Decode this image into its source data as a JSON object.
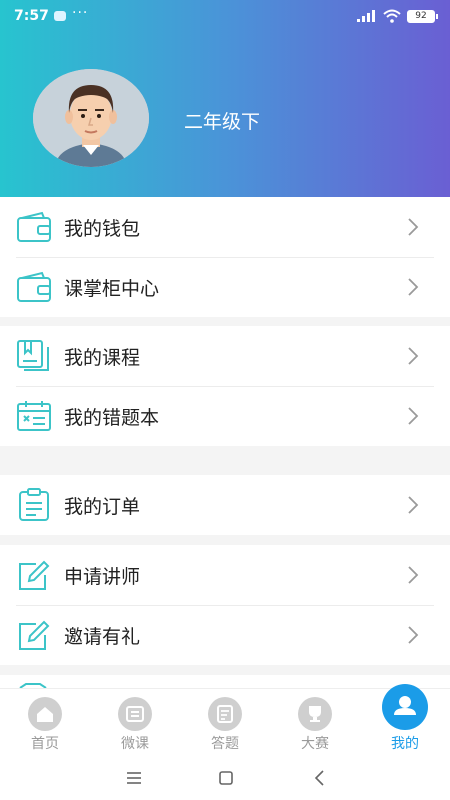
{
  "status": {
    "time": "7:57",
    "dots": "···",
    "battery": "92"
  },
  "profile": {
    "grade": "二年级下"
  },
  "menu_groups": [
    [
      {
        "label": "我的钱包"
      },
      {
        "label": "课掌柜中心"
      }
    ],
    [
      {
        "label": "我的课程"
      },
      {
        "label": "我的错题本"
      }
    ],
    [
      {
        "label": "我的订单"
      }
    ],
    [
      {
        "label": "申请讲师"
      },
      {
        "label": "邀请有礼"
      }
    ]
  ],
  "tabs": [
    {
      "label": "首页"
    },
    {
      "label": "微课"
    },
    {
      "label": "答题"
    },
    {
      "label": "大赛"
    },
    {
      "label": "我的"
    }
  ],
  "colors": {
    "accent": "#1b9ce8",
    "icon_teal": "#3cc4c8",
    "gradient_start": "#27c4cf",
    "gradient_end": "#6a5fd3"
  }
}
